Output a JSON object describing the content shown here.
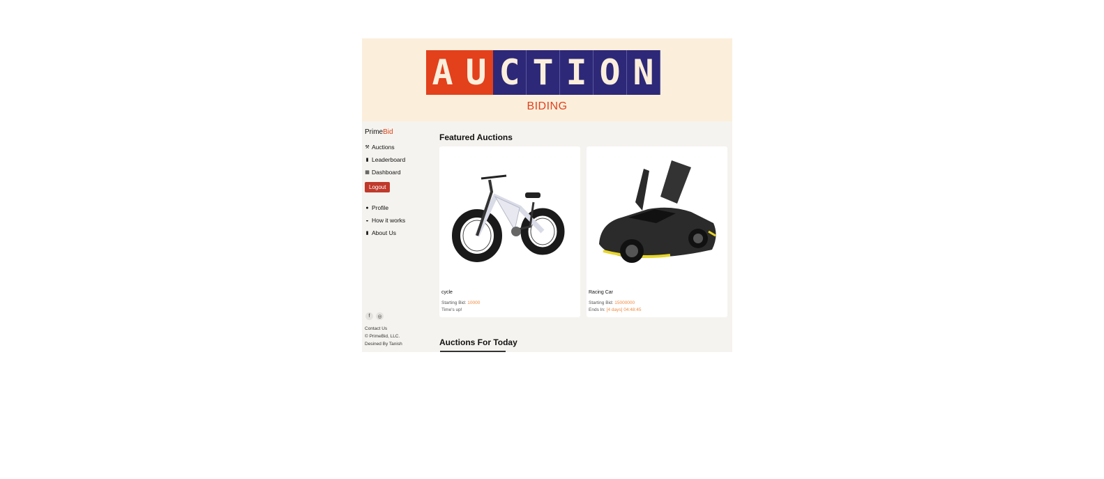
{
  "banner": {
    "logo_letters": [
      "A",
      "U",
      "C",
      "T",
      "I",
      "O",
      "N"
    ],
    "subtitle": "BIDING",
    "colors": {
      "red": "#e3401c",
      "blue": "#2e2878",
      "background": "#fbefdc"
    }
  },
  "sidebar": {
    "brand_prime": "Prime",
    "brand_bid": "Bid",
    "nav": [
      {
        "label": "Auctions",
        "icon": "gavel-icon",
        "glyph": "⚒"
      },
      {
        "label": "Leaderboard",
        "icon": "bar-chart-icon",
        "glyph": "▮"
      },
      {
        "label": "Dashboard",
        "icon": "dashboard-icon",
        "glyph": "▦"
      }
    ],
    "logout_label": "Logout",
    "nav2": [
      {
        "label": "Profile",
        "icon": "user-circle-icon",
        "glyph": "●"
      },
      {
        "label": "How it works",
        "icon": "help-icon",
        "glyph": "◒"
      },
      {
        "label": "About Us",
        "icon": "info-icon",
        "glyph": "▮"
      }
    ],
    "social": [
      {
        "icon": "facebook-icon",
        "glyph": "f"
      },
      {
        "icon": "instagram-icon",
        "glyph": "◎"
      }
    ],
    "footer": {
      "contact": "Contact Us",
      "copyright": "© PrimeBid, LLC.",
      "designed": "Desined By Tanish"
    }
  },
  "main": {
    "featured_title": "Featured Auctions",
    "today_title": "Auctions For Today",
    "cards": [
      {
        "name": "cycle",
        "starting_label": "Starting Bid:",
        "starting_value": "10000",
        "status": "Time's up!"
      },
      {
        "name": "Racing Car",
        "starting_label": "Starting Bid:",
        "starting_value": "15000000",
        "ends_label": "Ends In:",
        "ends_value": "[4 days] 04:48:45"
      }
    ]
  }
}
